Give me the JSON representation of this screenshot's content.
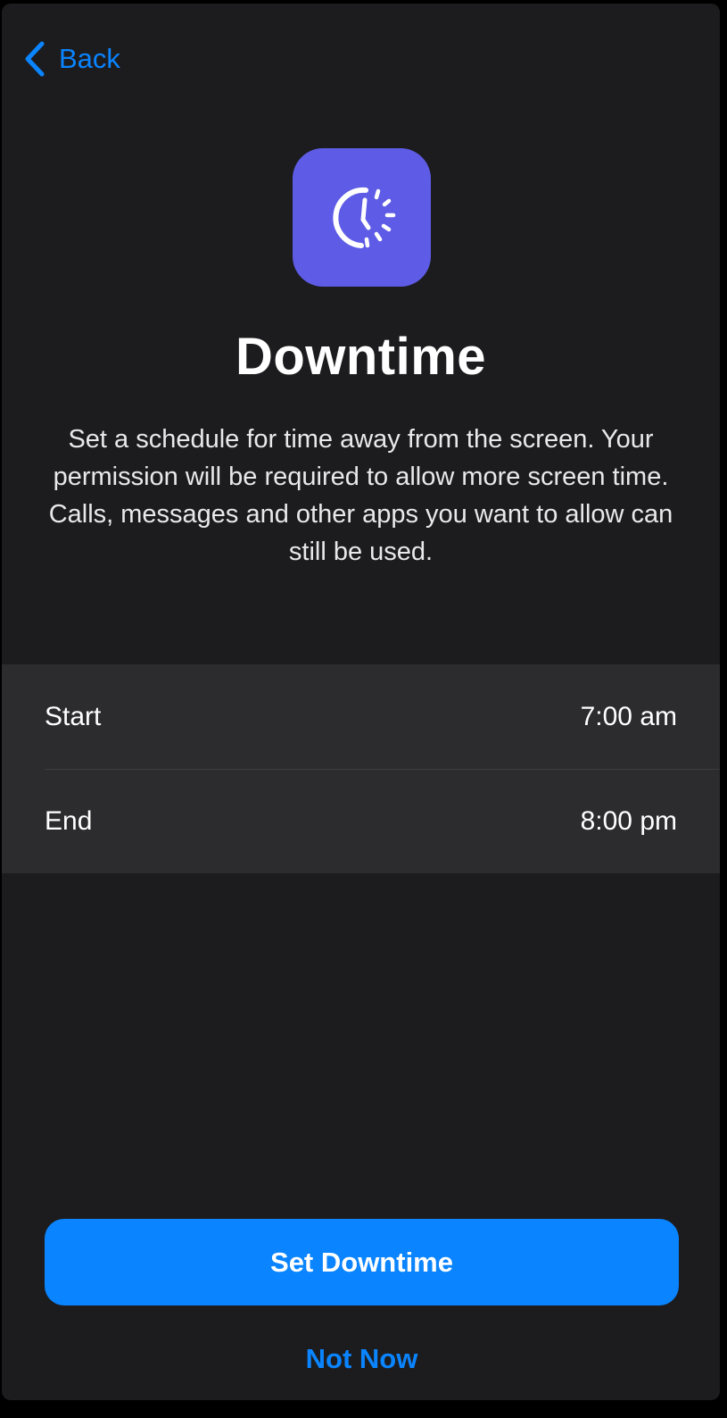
{
  "nav": {
    "back_label": "Back"
  },
  "header": {
    "icon": "downtime-clock-icon",
    "title": "Downtime",
    "description": "Set a schedule for time away from the screen. Your permission will be required to allow more screen time. Calls, messages and other apps you want to allow can still be used."
  },
  "schedule": {
    "rows": [
      {
        "label": "Start",
        "value": "7:00 am"
      },
      {
        "label": "End",
        "value": "8:00 pm"
      }
    ]
  },
  "actions": {
    "primary_label": "Set Downtime",
    "secondary_label": "Not Now"
  },
  "colors": {
    "accent": "#0a84ff",
    "icon_background": "#5e5ce6",
    "background": "#1c1c1e",
    "group_background": "#2c2c2e"
  }
}
